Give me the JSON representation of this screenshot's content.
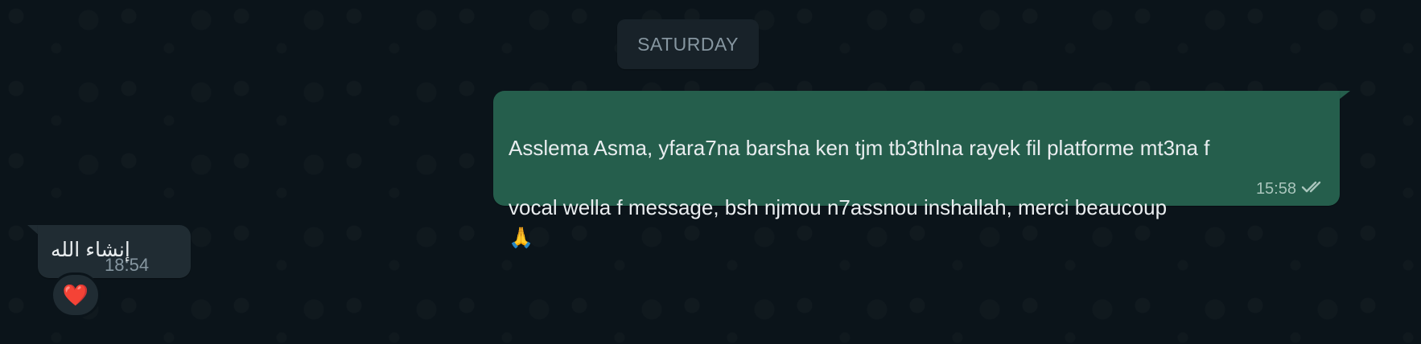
{
  "chat": {
    "date_separator": "SATURDAY",
    "outgoing_message": {
      "text_line_1": "Asslema Asma, yfara7na barsha ken tjm tb3thlna rayek fil platforme mt3na f",
      "text_line_2": "vocal wella f message, bsh njmou n7assnou inshallah, merci beaucoup",
      "emoji": "🙏",
      "time": "15:58",
      "status_icon": "double-check-icon"
    },
    "incoming_message": {
      "text": "إنشاء الله",
      "time": "18:54",
      "reaction": "❤️"
    }
  }
}
